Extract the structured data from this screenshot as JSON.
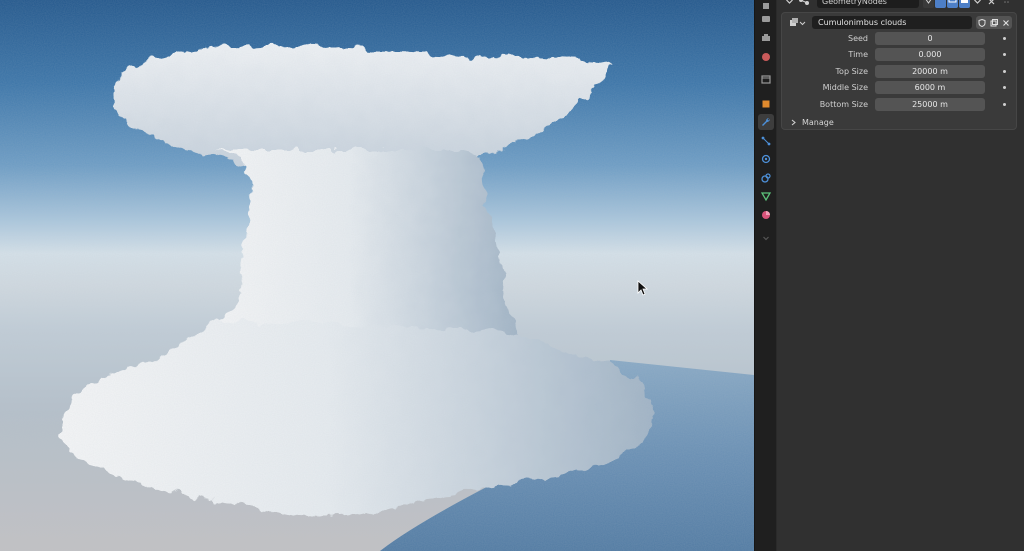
{
  "viewport": {
    "scene": "cumulonimbus cloud render over sea",
    "cursor_icon": "pointer-arrow"
  },
  "properties_tabs": [
    {
      "name": "tool",
      "color": "#9a9a9a"
    },
    {
      "name": "render",
      "color": "#9a9a9a"
    },
    {
      "name": "output",
      "color": "#9a9a9a"
    },
    {
      "name": "view-layer",
      "color": "#9a9a9a"
    },
    {
      "name": "scene",
      "color": "#c95a5a"
    },
    {
      "name": "world",
      "color": "#c95a5a"
    },
    {
      "name": "collection",
      "color": "#9a9a9a"
    },
    {
      "name": "object",
      "color": "#e08a2e"
    },
    {
      "name": "modifiers",
      "color": "#4d90d9"
    },
    {
      "name": "particles",
      "color": "#4d90d9"
    },
    {
      "name": "physics",
      "color": "#4d90d9"
    },
    {
      "name": "constraints",
      "color": "#4d90d9"
    },
    {
      "name": "data",
      "color": "#5cc27a"
    },
    {
      "name": "material",
      "color": "#d9547a"
    }
  ],
  "modifier": {
    "name": "GeometryNodes",
    "node_group": "Cumulonimbus clouds"
  },
  "inputs": [
    {
      "label": "Seed",
      "value": "0"
    },
    {
      "label": "Time",
      "value": "0.000"
    },
    {
      "label": "Top Size",
      "value": "20000 m"
    },
    {
      "label": "Middle Size",
      "value": "6000 m"
    },
    {
      "label": "Bottom Size",
      "value": "25000 m"
    }
  ],
  "manage_label": "Manage",
  "colors": {
    "panel_bg": "#303030",
    "field_bg": "#545454",
    "accent_blue": "#4d90d9"
  }
}
